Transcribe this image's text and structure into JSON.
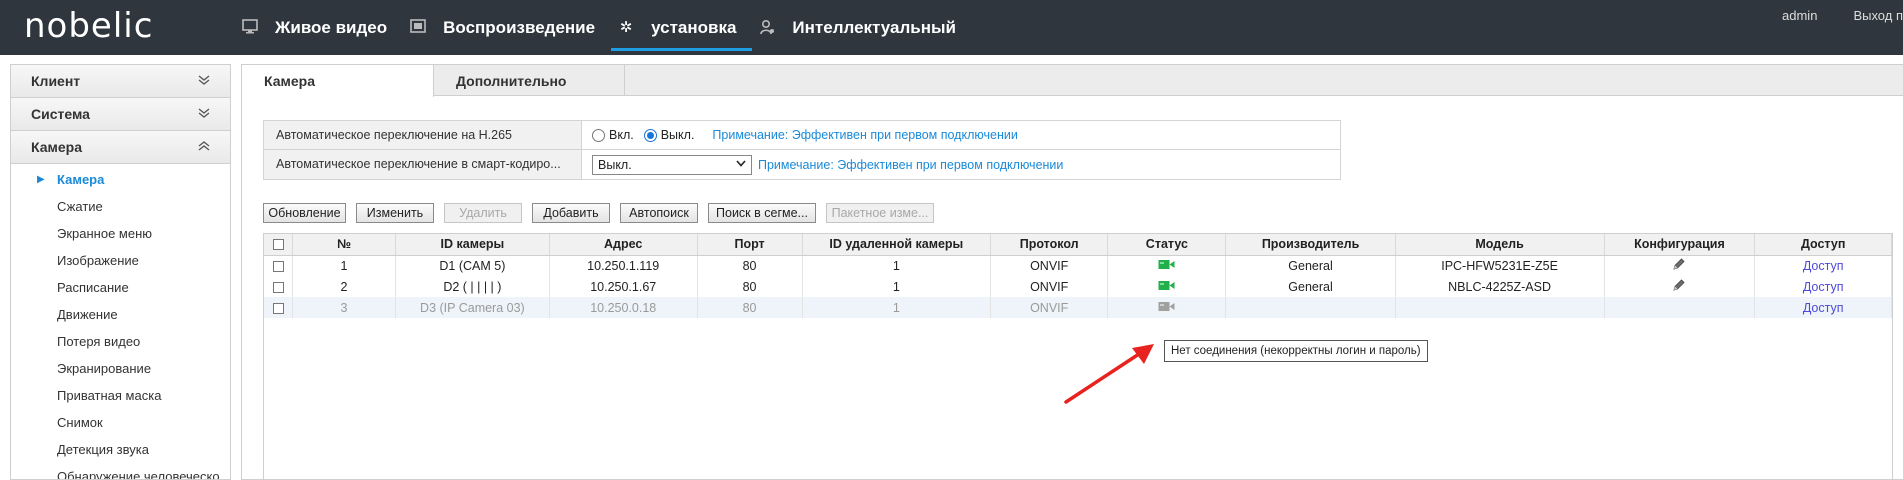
{
  "header": {
    "logo": "nobelic",
    "nav": [
      {
        "label": "Живое видео",
        "icon": "monitor-icon"
      },
      {
        "label": "Воспроизведение",
        "icon": "film-icon"
      },
      {
        "label": "установка",
        "icon": "gear-icon",
        "active": true
      },
      {
        "label": "Интеллектуальный",
        "icon": "person-icon"
      }
    ],
    "user": "admin",
    "logout": "Выход п"
  },
  "sidebar": {
    "sections": [
      {
        "label": "Клиент",
        "expanded": false
      },
      {
        "label": "Система",
        "expanded": false
      },
      {
        "label": "Камера",
        "expanded": true
      }
    ],
    "camera_items": [
      "Камера",
      "Сжатие",
      "Экранное меню",
      "Изображение",
      "Расписание",
      "Движение",
      "Потеря видео",
      "Экранирование",
      "Приватная маска",
      "Снимок",
      "Детекция звука",
      "Обнаружение человеческо..."
    ]
  },
  "tabs": [
    "Камера",
    "Дополнительно"
  ],
  "options": {
    "h265_label": "Автоматическое переключение на H.265",
    "h265_on": "Вкл.",
    "h265_off": "Выкл.",
    "h265_note": "Примечание: Эффективен при первом подключении",
    "smart_label": "Автоматическое переключение в смарт-кодиро...",
    "smart_value": "Выкл.",
    "smart_note": "Примечание: Эффективен при первом подключении"
  },
  "toolbar": {
    "refresh": "Обновление",
    "edit": "Изменить",
    "delete": "Удалить",
    "add": "Добавить",
    "autosearch": "Автопоиск",
    "segment_search": "Поиск в сегме...",
    "batch": "Пакетное изме..."
  },
  "table": {
    "columns": [
      "№",
      "ID камеры",
      "Адрес",
      "Порт",
      "ID удаленной камеры",
      "Протокол",
      "Статус",
      "Производитель",
      "Модель",
      "Конфигурация",
      "Доступ"
    ],
    "rows": [
      {
        "no": "1",
        "id": "D1 (CAM 5)",
        "addr": "10.250.1.119",
        "port": "80",
        "remote": "1",
        "proto": "ONVIF",
        "status": "online",
        "vendor": "General",
        "model": "IPC-HFW5231E-Z5E",
        "access": "Доступ"
      },
      {
        "no": "2",
        "id": "D2 ( | | | | )",
        "addr": "10.250.1.67",
        "port": "80",
        "remote": "1",
        "proto": "ONVIF",
        "status": "online",
        "vendor": "General",
        "model": "NBLC-4225Z-ASD",
        "access": "Доступ"
      },
      {
        "no": "3",
        "id": "D3 (IP Camera 03)",
        "addr": "10.250.0.18",
        "port": "80",
        "remote": "1",
        "proto": "ONVIF",
        "status": "offline",
        "vendor": "",
        "model": "",
        "access": "Доступ"
      }
    ]
  },
  "tooltip": "Нет соединения  (некорректны логин и пароль)",
  "colors": {
    "accent": "#1a8ad8",
    "online": "#22b04b",
    "offline": "#9a9a9a",
    "arrow": "#e8231f"
  }
}
